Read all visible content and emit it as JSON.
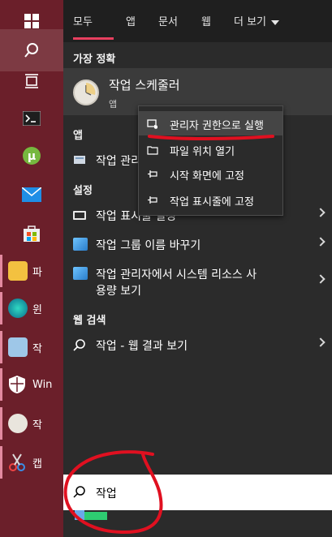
{
  "tabs": [
    {
      "label": "모두"
    },
    {
      "label": "앱"
    },
    {
      "label": "문서"
    },
    {
      "label": "웹"
    },
    {
      "label": "더 보기"
    }
  ],
  "sections": {
    "best": "가장 정확",
    "apps": "앱",
    "settings": "설정",
    "web": "웹 검색"
  },
  "best_match": {
    "title": "작업 스케줄러",
    "subtitle": "앱"
  },
  "app_row": {
    "label": "작업 관리"
  },
  "settings_rows": [
    {
      "label": "작업 표시줄 설정"
    },
    {
      "label": "작업 그룹 이름 바꾸기"
    },
    {
      "label_line1": "작업 관리자에서 시스템 리소스 사",
      "label_line2": "용량 보기"
    }
  ],
  "web_row": {
    "label": "작업 - 웹 결과 보기"
  },
  "context_menu": [
    {
      "label": "관리자 권한으로 실행"
    },
    {
      "label": "파일 위치 열기"
    },
    {
      "label": "시작 화면에 고정"
    },
    {
      "label": "작업 표시줄에 고정"
    }
  ],
  "taskbar_apps": [
    {
      "label": "파"
    },
    {
      "label": "윈"
    },
    {
      "label": "작"
    },
    {
      "label": "Win"
    },
    {
      "label": "작"
    },
    {
      "label": "캡"
    }
  ],
  "search": {
    "value": "작업"
  },
  "colors": {
    "taskbar": "#6b1f2a",
    "accent": "#e8405f",
    "annotation": "#e01020"
  }
}
